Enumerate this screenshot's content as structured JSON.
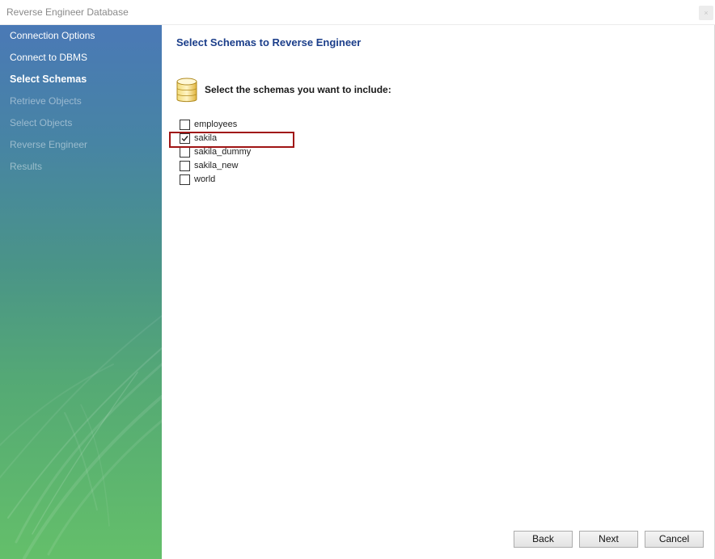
{
  "window": {
    "title": "Reverse Engineer Database",
    "close_glyph": "×"
  },
  "sidebar": {
    "steps": [
      {
        "label": "Connection Options",
        "state": "done"
      },
      {
        "label": "Connect to DBMS",
        "state": "done"
      },
      {
        "label": "Select Schemas",
        "state": "current"
      },
      {
        "label": "Retrieve Objects",
        "state": "pending"
      },
      {
        "label": "Select Objects",
        "state": "pending"
      },
      {
        "label": "Reverse Engineer",
        "state": "pending"
      },
      {
        "label": "Results",
        "state": "pending"
      }
    ]
  },
  "main": {
    "heading": "Select Schemas to Reverse Engineer",
    "prompt": "Select the schemas you want to include:",
    "icon": "database-icon",
    "schemas": [
      {
        "name": "employees",
        "checked": false
      },
      {
        "name": "sakila",
        "checked": true
      },
      {
        "name": "sakila_dummy",
        "checked": false
      },
      {
        "name": "sakila_new",
        "checked": false
      },
      {
        "name": "world",
        "checked": false
      }
    ]
  },
  "buttons": {
    "back": "Back",
    "next": "Next",
    "cancel": "Cancel"
  },
  "colors": {
    "heading": "#1b3e8a",
    "highlight": "#a01515",
    "sidebar_top": "#4a79b6",
    "sidebar_bottom": "#64bf6a"
  }
}
